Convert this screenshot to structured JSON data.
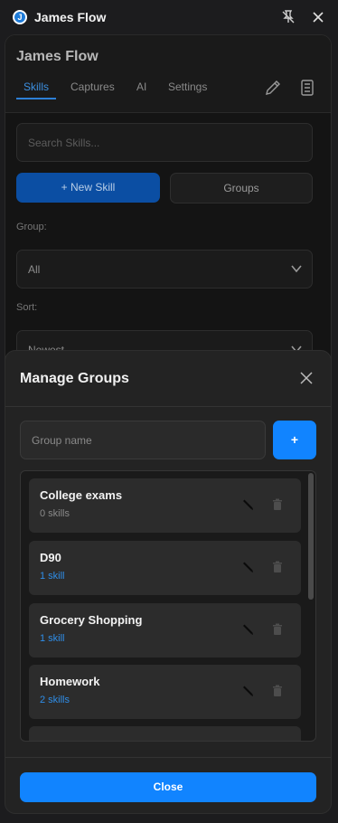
{
  "window": {
    "title": "James Flow",
    "logo_letter": "J"
  },
  "header": {
    "title": "James Flow",
    "tabs": [
      {
        "label": "Skills",
        "active": true
      },
      {
        "label": "Captures",
        "active": false
      },
      {
        "label": "AI",
        "active": false
      },
      {
        "label": "Settings",
        "active": false
      }
    ]
  },
  "skills": {
    "search_placeholder": "Search Skills...",
    "new_skill_label": "+ New Skill",
    "groups_label": "Groups",
    "group_label": "Group:",
    "group_value": "All",
    "sort_label": "Sort:",
    "sort_value": "Newest"
  },
  "modal": {
    "title": "Manage Groups",
    "input_placeholder": "Group name",
    "add_label": "+",
    "groups": [
      {
        "name": "College exams",
        "count": "0 skills"
      },
      {
        "name": "D90",
        "count": "1 skill"
      },
      {
        "name": "Grocery Shopping",
        "count": "1 skill"
      },
      {
        "name": "Homework",
        "count": "2 skills"
      }
    ],
    "close_label": "Close"
  },
  "colors": {
    "accent": "#1184ff",
    "count_accent": "#2f8ee8",
    "tab_active": "#3c8fe0"
  },
  "icons": [
    "app-logo-icon",
    "pin-off-icon",
    "close-icon",
    "pencil-icon",
    "notebook-icon",
    "chevron-down-icon",
    "edit-icon",
    "trash-icon"
  ]
}
